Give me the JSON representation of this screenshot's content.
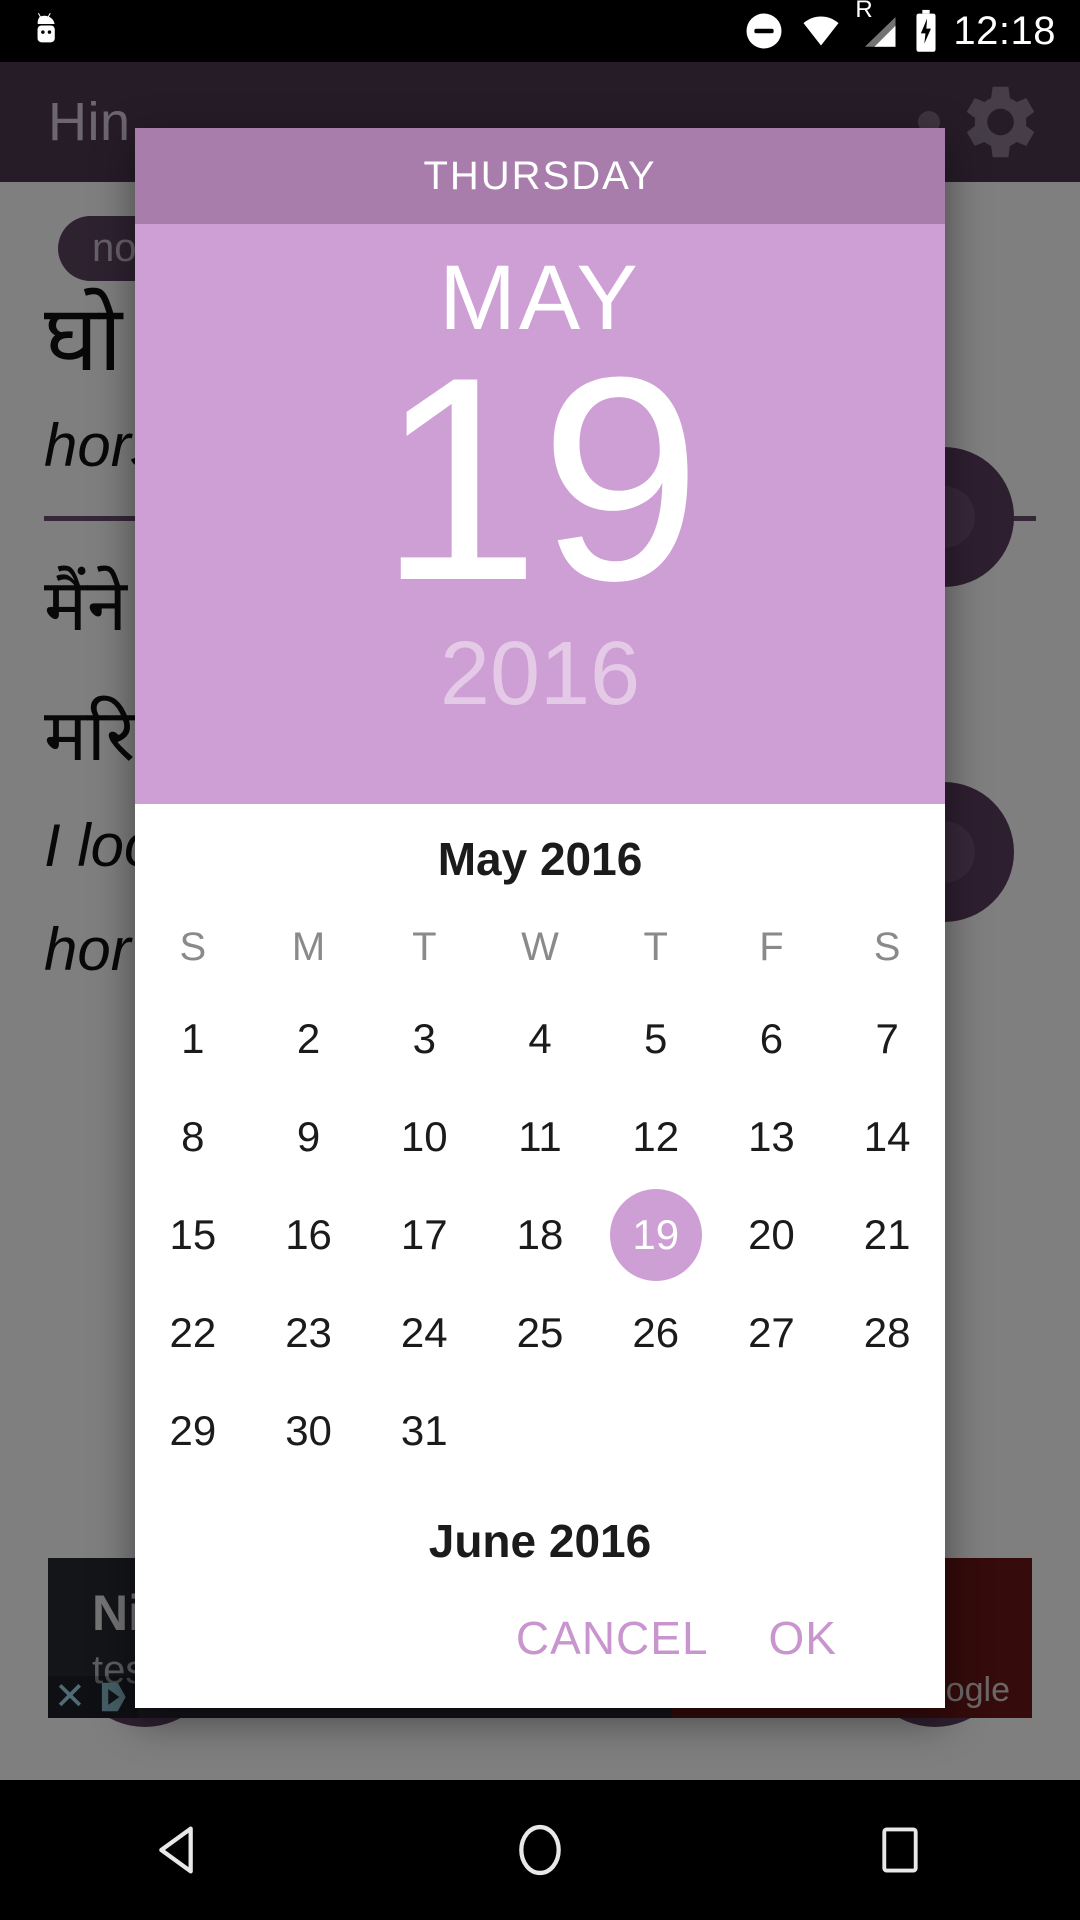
{
  "status_bar": {
    "time": "12:18",
    "icons": [
      "android-robot-icon",
      "do-not-disturb-icon",
      "wifi-icon",
      "roaming-signal-icon",
      "battery-charging-icon"
    ],
    "roaming_label": "R"
  },
  "background_app": {
    "title": "Hin",
    "settings_icon": "gear-icon",
    "part_of_speech": "noun",
    "headword": "घो",
    "gloss": "hors",
    "example_line1": "मैंने",
    "example_line2": "मरि",
    "translation_line1": "I loo",
    "translation_line2": "hor",
    "prev_icon": "arrow-left-icon",
    "next_icon": "arrow-right-icon",
    "ad": {
      "title": "Nic",
      "subtitle": "tes",
      "brand": "ogle",
      "close_icon": "close-icon",
      "adchoices_icon": "adchoices-icon"
    }
  },
  "dialog": {
    "weekday": "THURSDAY",
    "month_short": "MAY",
    "day": "19",
    "year": "2016",
    "accent_color": "#CE9FD4",
    "header_color": "#A87DAC",
    "button_color": "#C895CE",
    "cancel_label": "CANCEL",
    "ok_label": "OK",
    "months": [
      {
        "title": "May 2016",
        "dow": [
          "S",
          "M",
          "T",
          "W",
          "T",
          "F",
          "S"
        ],
        "lead_blanks": 0,
        "days": [
          1,
          2,
          3,
          4,
          5,
          6,
          7,
          8,
          9,
          10,
          11,
          12,
          13,
          14,
          15,
          16,
          17,
          18,
          19,
          20,
          21,
          22,
          23,
          24,
          25,
          26,
          27,
          28,
          29,
          30,
          31
        ],
        "selected_day": 19
      },
      {
        "title": "June 2016"
      }
    ]
  },
  "nav_bar": {
    "back_icon": "back-triangle-icon",
    "home_icon": "home-circle-icon",
    "recents_icon": "recents-square-icon"
  }
}
